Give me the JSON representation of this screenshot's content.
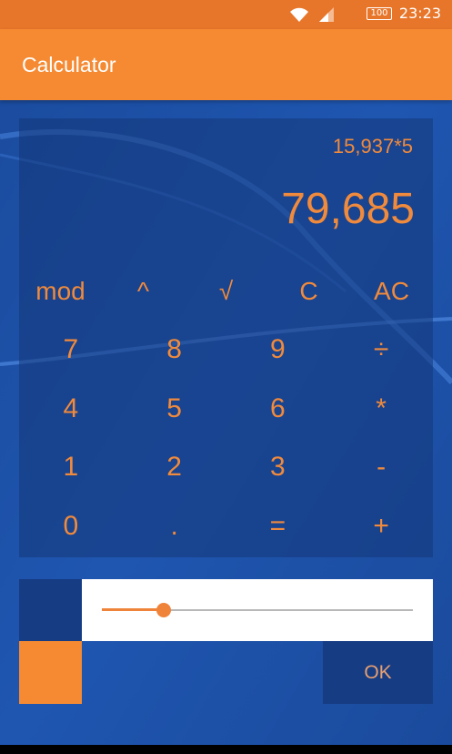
{
  "status_bar": {
    "time": "23:23",
    "battery": "100",
    "icons": [
      "wifi-icon",
      "signal-icon",
      "battery-icon"
    ]
  },
  "app_bar": {
    "title": "Calculator"
  },
  "display": {
    "expression": "15,937*5",
    "result": "79,685"
  },
  "function_row": [
    "mod",
    "^",
    "√",
    "C",
    "AC"
  ],
  "keypad": [
    [
      "7",
      "8",
      "9",
      "÷"
    ],
    [
      "4",
      "5",
      "6",
      "*"
    ],
    [
      "1",
      "2",
      "3",
      "-"
    ],
    [
      "0",
      ".",
      "=",
      "+"
    ]
  ],
  "slider": {
    "value_fraction": 0.2
  },
  "ok_label": "OK",
  "colors": {
    "accent": "#f58a33",
    "background": "#1c4fa3",
    "panel_dark": "#163c84",
    "key_text": "#f08a3c"
  }
}
